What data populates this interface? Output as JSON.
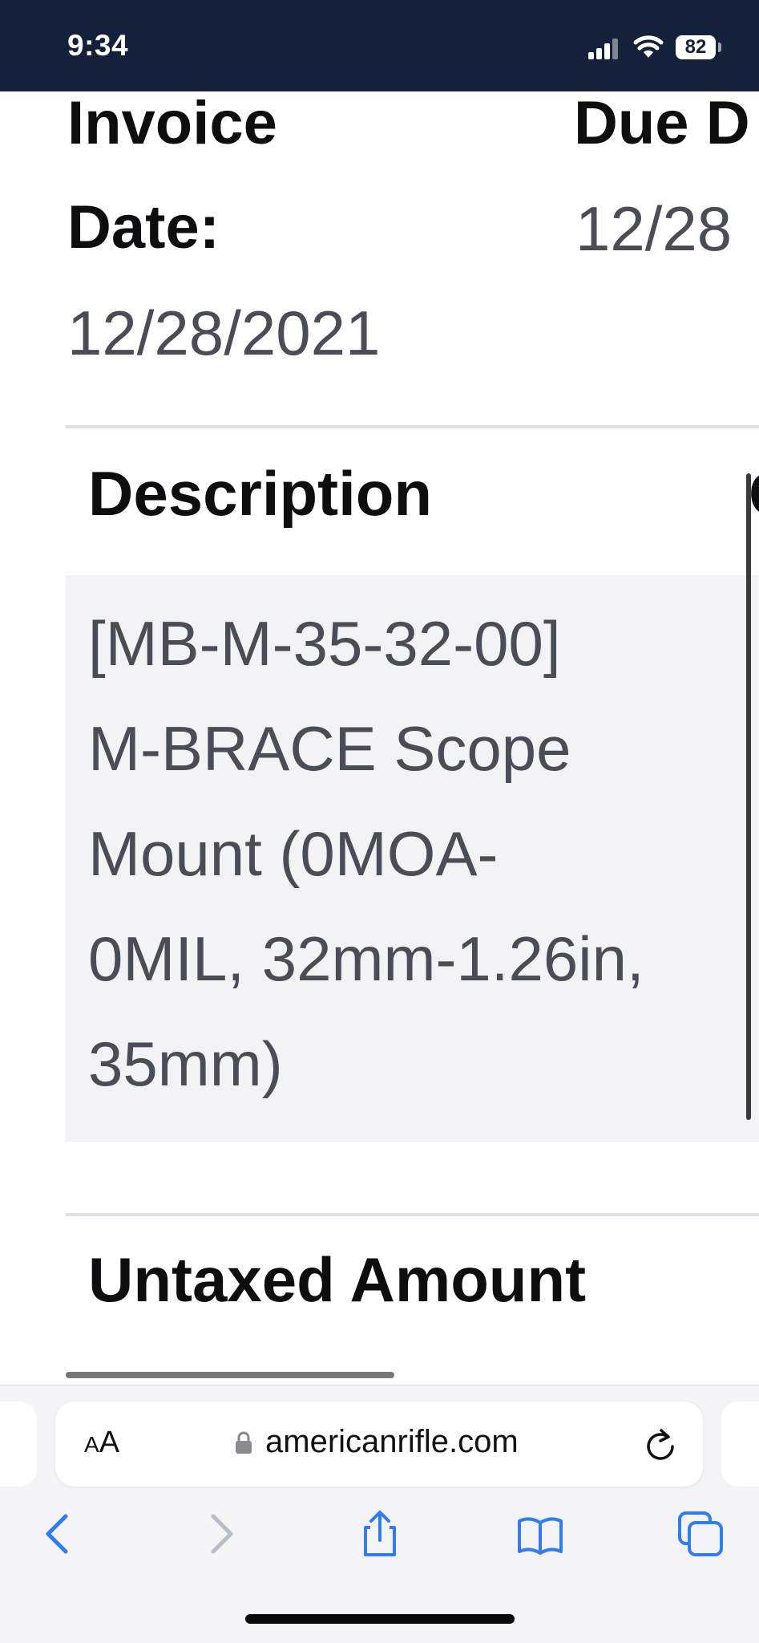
{
  "status_bar": {
    "time": "9:34",
    "battery": "82"
  },
  "invoice": {
    "invoice_date_label_line1": "Invoice",
    "invoice_date_label_line2": "Date:",
    "invoice_date_value": "12/28/2021",
    "due_date_label": "Due D",
    "due_date_value": "12/28"
  },
  "table": {
    "header_description": "Description",
    "header_next_peek": "Q",
    "description_lines": [
      "[MB-M-35-32-00]",
      "M-BRACE Scope",
      "Mount (0MOA-",
      "0MIL, 32mm-1.26in,",
      "35mm)"
    ],
    "untaxed_header": "Untaxed Amount"
  },
  "browser": {
    "text_size_button_small": "A",
    "text_size_button_large": "A",
    "url": "americanrifle.com",
    "icons": [
      "lock-icon",
      "reload-icon",
      "back-icon",
      "forward-icon",
      "share-icon",
      "bookmarks-icon",
      "tabs-icon"
    ],
    "accent_color": "#2f7cf6",
    "disabled_color": "#b8bcc6"
  }
}
